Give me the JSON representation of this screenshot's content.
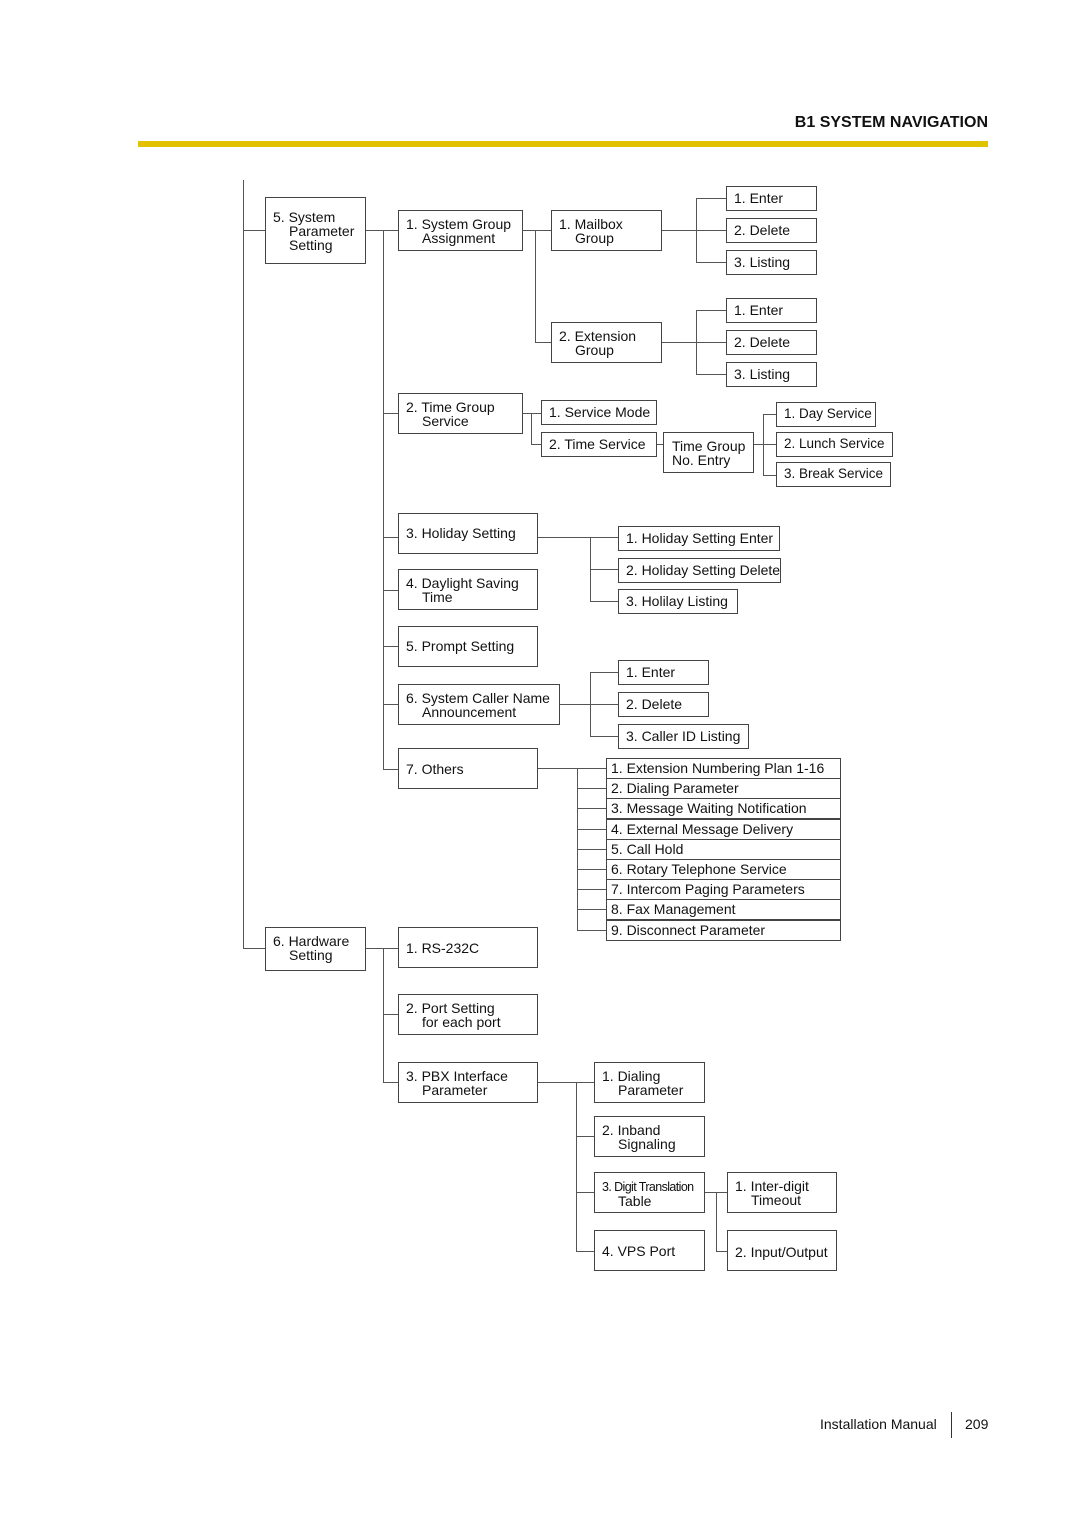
{
  "header": {
    "title": "B1 SYSTEM NAVIGATION",
    "accent_color": "#e2c100"
  },
  "tree": {
    "system_parameter": {
      "label": [
        "5. System",
        "Parameter",
        "Setting"
      ],
      "system_group": {
        "label": [
          "1. System Group",
          "Assignment"
        ],
        "mailbox_group": {
          "label": [
            "1. Mailbox",
            "Group"
          ],
          "items": [
            "1. Enter",
            "2. Delete",
            "3. Listing"
          ]
        },
        "extension_group": {
          "label": [
            "2. Extension",
            "Group"
          ],
          "items": [
            "1. Enter",
            "2. Delete",
            "3. Listing"
          ]
        }
      },
      "time_group": {
        "label": [
          "2. Time Group",
          "Service"
        ],
        "service_mode": "1. Service Mode",
        "time_service": "2. Time Service",
        "entry": [
          "Time Group",
          "No. Entry"
        ],
        "items": [
          "1. Day Service",
          "2. Lunch Service",
          "3. Break Service"
        ]
      },
      "holiday": {
        "label": "3. Holiday Setting",
        "items": [
          "1. Holiday Setting Enter",
          "2. Holiday Setting Delete",
          "3. Holilay Listing"
        ]
      },
      "daylight": {
        "label": [
          "4. Daylight Saving",
          "Time"
        ]
      },
      "prompt": {
        "label": "5. Prompt Setting"
      },
      "caller_name": {
        "label": [
          "6. System Caller Name",
          "Announcement"
        ],
        "items": [
          "1. Enter",
          "2. Delete",
          "3. Caller ID Listing"
        ]
      },
      "others": {
        "label": "7. Others",
        "items": [
          "1. Extension Numbering Plan 1-16",
          "2. Dialing Parameter",
          "3. Message Waiting Notification",
          "4. External Message Delivery",
          "5. Call Hold",
          "6. Rotary Telephone Service",
          "7. Intercom Paging Parameters",
          "8. Fax Management",
          "9. Disconnect Parameter"
        ]
      }
    },
    "hardware": {
      "label": [
        "6. Hardware",
        "Setting"
      ],
      "rs232c": "1. RS-232C",
      "port": [
        "2. Port Setting",
        "for each port"
      ],
      "pbx": {
        "label": [
          "3. PBX Interface",
          "Parameter"
        ],
        "dialing": [
          "1. Dialing",
          "Parameter"
        ],
        "inband": [
          "2. Inband",
          "Signaling"
        ],
        "digit": {
          "label": [
            "3. Digit Translation",
            "Table"
          ],
          "items": [
            [
              "1. Inter-digit",
              "Timeout"
            ],
            "2. Input/Output"
          ]
        },
        "vps": "4. VPS Port"
      }
    }
  },
  "footer": {
    "manual": "Installation Manual",
    "page": "209"
  }
}
